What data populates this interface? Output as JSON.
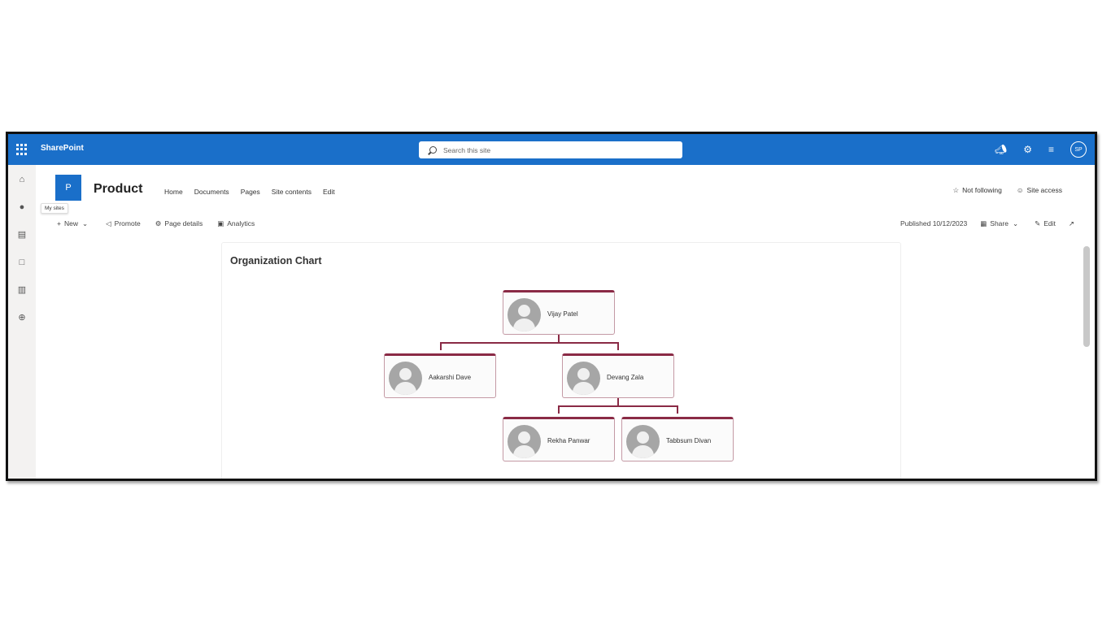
{
  "suitebar": {
    "app_name": "SharePoint",
    "search_placeholder": "Search this site",
    "icons": [
      "waffle-icon",
      "megaphone-icon",
      "settings-icon",
      "signal-icon",
      "avatar"
    ],
    "avatar_initials": "SP",
    "color": "#1a6fc9"
  },
  "rail": {
    "items": [
      "home-icon",
      "my-sites-icon",
      "news-icon",
      "files-icon",
      "lists-icon",
      "create-icon"
    ],
    "tooltip": "My sites"
  },
  "site": {
    "logo_letter": "P",
    "title": "Product",
    "nav": [
      "Home",
      "Documents",
      "Pages",
      "Site contents",
      "Edit"
    ],
    "follow_label": "Not following",
    "access_label": "Site access"
  },
  "command_bar": {
    "new_label": "New",
    "promote_label": "Promote",
    "page_details_label": "Page details",
    "analytics_label": "Analytics",
    "published_label": "Published 10/12/2023",
    "share_label": "Share",
    "edit_label": "Edit"
  },
  "webpart": {
    "title": "Organization Chart",
    "accent_color": "#8a2a45",
    "people": [
      {
        "name": "Vijay Patel"
      },
      {
        "name": "Aakarshi Dave"
      },
      {
        "name": "Devang Zala"
      },
      {
        "name": "Rekha Panwar"
      },
      {
        "name": "Tabbsum Divan"
      }
    ]
  }
}
